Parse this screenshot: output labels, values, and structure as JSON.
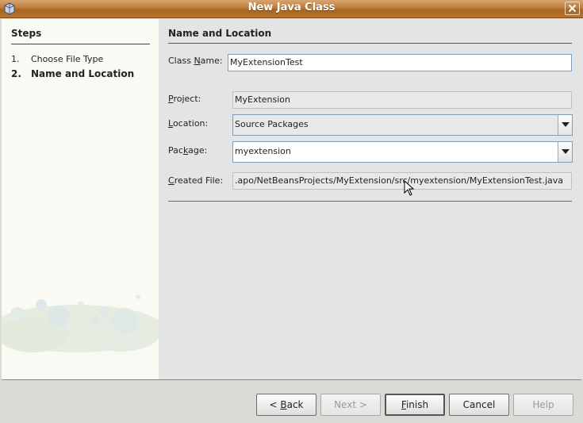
{
  "window": {
    "title": "New Java Class"
  },
  "steps": {
    "heading": "Steps",
    "items": [
      {
        "number": "1.",
        "label": "Choose File Type",
        "active": false
      },
      {
        "number": "2.",
        "label": "Name and Location",
        "active": true
      }
    ]
  },
  "panel": {
    "title": "Name and Location",
    "class_name": {
      "label_pre": "Class ",
      "label_mnemonic": "N",
      "label_post": "ame:",
      "value": "MyExtensionTest"
    },
    "project": {
      "label_pre": "",
      "label_mnemonic": "P",
      "label_post": "roject:",
      "value": "MyExtension"
    },
    "location": {
      "label_pre": "",
      "label_mnemonic": "L",
      "label_post": "ocation:",
      "value": "Source Packages"
    },
    "package": {
      "label_pre": "Pac",
      "label_mnemonic": "k",
      "label_post": "age:",
      "value": "myextension"
    },
    "created_file": {
      "label_pre": "",
      "label_mnemonic": "C",
      "label_post": "reated File:",
      "value": ".apo/NetBeansProjects/MyExtension/src/myextension/MyExtensionTest.java"
    }
  },
  "buttons": {
    "back": {
      "pre": "< ",
      "mnemonic": "B",
      "post": "ack"
    },
    "next": {
      "label": "Next >"
    },
    "finish": {
      "pre": "",
      "mnemonic": "F",
      "post": "inish"
    },
    "cancel": {
      "label": "Cancel"
    },
    "help": {
      "label": "Help"
    }
  },
  "colors": {
    "titlebar": "#b87530",
    "field_border": "#7f9db9"
  },
  "icons": {
    "window": "java-cup-icon",
    "close": "close-icon",
    "dropdown": "chevron-down-icon",
    "cursor": "mouse-pointer-icon"
  }
}
